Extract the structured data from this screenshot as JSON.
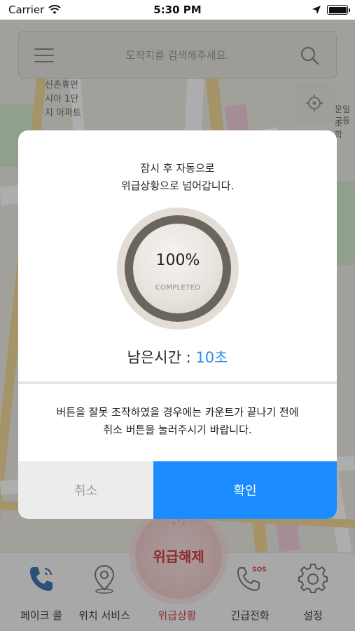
{
  "status_bar": {
    "carrier": "Carrier",
    "time": "5:30 PM"
  },
  "search": {
    "placeholder": "도착지를 검색해주세요."
  },
  "map": {
    "labels": [
      "신촌휴먼",
      "시아 1단",
      "지 아파트"
    ],
    "side_label": [
      "문일조",
      "고등학"
    ]
  },
  "dialog": {
    "message_line1": "잠시 후 자동으로",
    "message_line2": "위급상황으로 넘어갑니다.",
    "progress_text": "100%",
    "progress_value": 1.0,
    "progress_status": "COMPLETED",
    "remaining_label": "남은시간 : ",
    "remaining_value": "10초",
    "notice_line1": "버튼을 잘못 조작하였을 경우에는 카운트가 끝나기 전에",
    "notice_line2": "취소 버튼을 눌러주시기 바랍니다.",
    "cancel_label": "취소",
    "confirm_label": "확인"
  },
  "center_button": {
    "label": "위급해제"
  },
  "tabs": [
    {
      "label": "페이크 콜",
      "icon": "phone-icon"
    },
    {
      "label": "위치 서비스",
      "icon": "location-pin-icon"
    },
    {
      "label": "위급상황",
      "icon": "siren-icon",
      "active": true
    },
    {
      "label": "긴급전화",
      "icon": "sos-phone-icon"
    },
    {
      "label": "설정",
      "icon": "gear-icon"
    }
  ],
  "colors": {
    "accent_blue": "#1a8cff",
    "remaining_blue": "#2d8cf0",
    "emergency_red": "#d42a2a"
  }
}
